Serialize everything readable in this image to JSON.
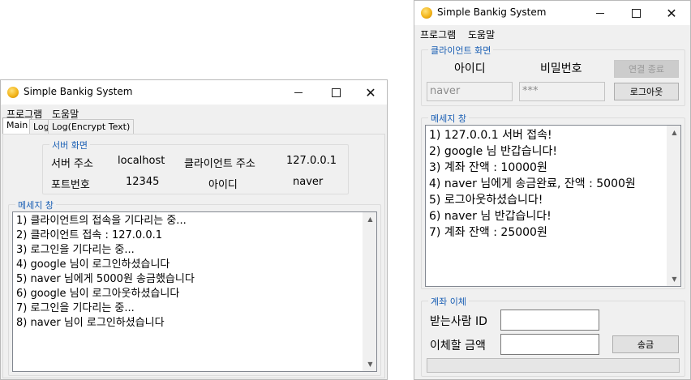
{
  "server_window": {
    "title": "Simple Bankig System",
    "menu": [
      "프로그램",
      "도움말"
    ],
    "tabs": [
      "Main",
      "Log",
      "Log(Encrypt Text)"
    ],
    "server_group": {
      "legend": "서버 화면",
      "server_address_label": "서버 주소",
      "server_address_value": "localhost",
      "client_address_label": "클라이언트 주소",
      "client_address_value": "127.0.0.1",
      "port_label": "포트번호",
      "port_value": "12345",
      "id_label": "아이디",
      "id_value": "naver"
    },
    "message_group": {
      "legend": "메세지 창",
      "lines": [
        "1) 클라이언트의 접속을 기다리는 중...",
        "2) 클라이언트 접속 : 127.0.0.1",
        "3) 로그인을 기다리는 중...",
        "4) google 님이 로그인하셨습니다",
        "5) naver 님에게 5000원 송금했습니다",
        "6) google 님이 로그아웃하셨습니다",
        "7) 로그인을 기다리는 중...",
        "8) naver 님이 로그인하셨습니다"
      ]
    }
  },
  "client_window": {
    "title": "Simple Bankig System",
    "menu": [
      "프로그램",
      "도움말"
    ],
    "client_group": {
      "legend": "클라이언트 화면",
      "id_label": "아이디",
      "password_label": "비밀번호",
      "disconnect_button": "연결 종료",
      "id_value": "naver",
      "password_value": "***",
      "logout_button": "로그아웃"
    },
    "message_group": {
      "legend": "메세지 창",
      "lines": [
        "1) 127.0.0.1 서버 접속!",
        "2) google 님 반갑습니다!",
        "3) 계좌 잔액 : 10000원",
        "4) naver 님에게 송금완료, 잔액 : 5000원",
        "5) 로그아웃하셨습니다!",
        "6) naver 님 반갑습니다!",
        "7) 계좌 잔액 : 25000원"
      ]
    },
    "transfer_group": {
      "legend": "계좌 이체",
      "recipient_label": "받는사람 ID",
      "recipient_value": "",
      "amount_label": "이체할 금액",
      "amount_value": "",
      "send_button": "송금",
      "progress_percent": 0
    }
  },
  "colors": {
    "legend_blue": "#1a5fb4",
    "window_bg": "#f0f0f0",
    "titlebar_bg": "#ffffff"
  },
  "icons": {
    "app": "coin-icon",
    "minimize": "minimize-icon",
    "maximize": "maximize-icon",
    "close": "close-icon",
    "scroll_up": "chevron-up-icon",
    "scroll_down": "chevron-down-icon"
  }
}
